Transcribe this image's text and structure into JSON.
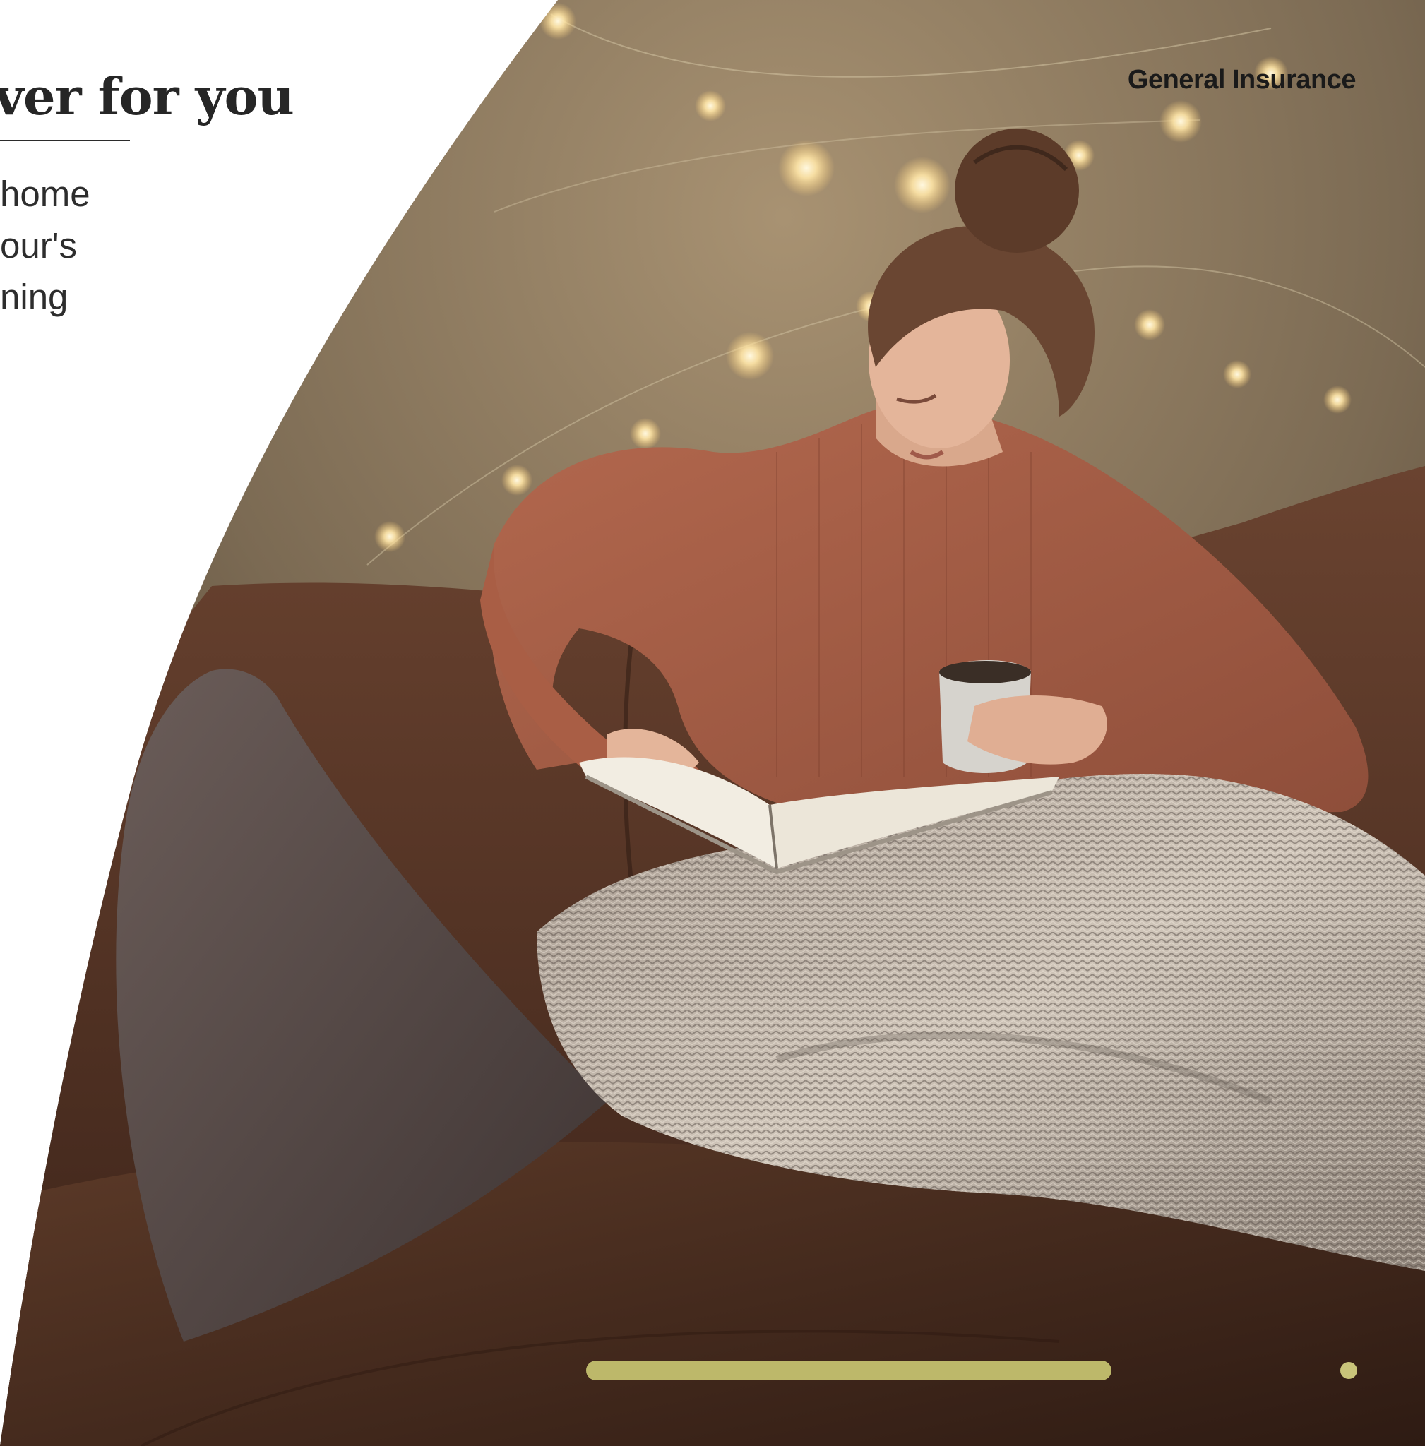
{
  "hero": {
    "headline": "ver for you",
    "body_lines": [
      " home",
      "our's",
      "ning"
    ]
  },
  "nav": {
    "label": "General Insurance"
  },
  "carousel": {
    "progress_fraction": 1.0,
    "accent_color": "#bdb86a"
  },
  "image": {
    "subject": "woman-reading-on-sofa"
  }
}
